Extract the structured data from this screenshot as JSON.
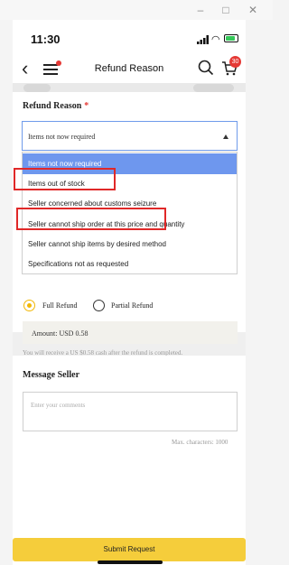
{
  "window": {
    "minimize": "–",
    "maximize": "□",
    "close": "✕"
  },
  "status": {
    "time": "11:30"
  },
  "nav": {
    "back": "‹",
    "title": "Refund Reason",
    "cart_count": "30"
  },
  "refund_reason": {
    "label": "Refund Reason",
    "required_mark": "*",
    "selected_value": "Items not now required",
    "options": [
      "Items not now required",
      "Items out of stock",
      "Seller concerned about customs seizure",
      "Seller cannot ship order at this price and quantity",
      "Seller cannot ship items by desired method",
      "Specifications not as requested"
    ]
  },
  "refund_type": {
    "full": "Full Refund",
    "partial": "Partial Refund",
    "selected": "Full Refund"
  },
  "amount": {
    "text": "Amount: USD  0.58",
    "note": "You will receive a US $0.58 cash after the refund is completed."
  },
  "message": {
    "label": "Message Seller",
    "placeholder": "Enter your comments",
    "max_chars": "Max. characters: 1000"
  },
  "submit": {
    "label": "Submit Request"
  },
  "colors": {
    "accent": "#f5cd3b",
    "select_highlight": "#6e97ee",
    "annotation": "#e02828"
  }
}
